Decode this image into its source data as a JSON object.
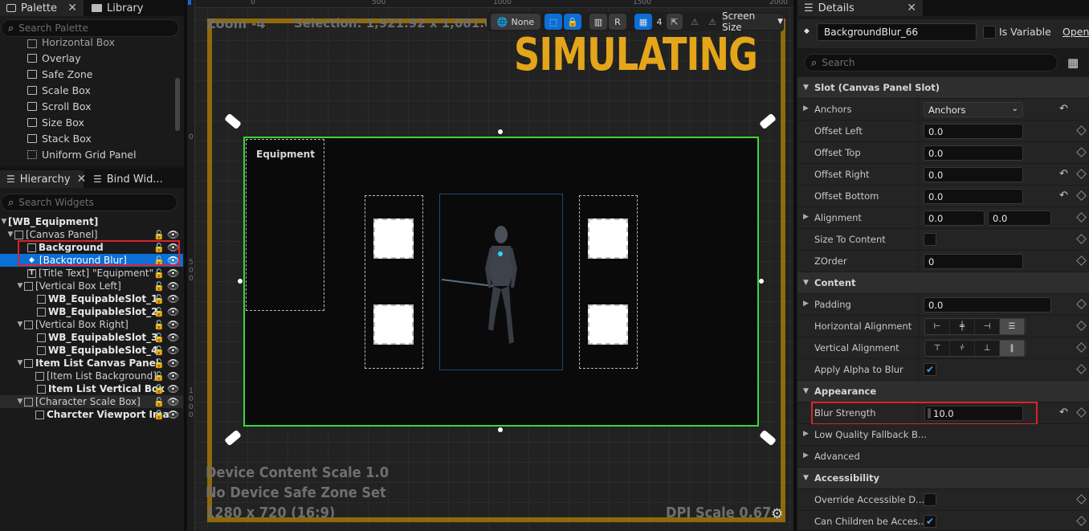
{
  "palette": {
    "tab_label": "Palette",
    "library_tab_label": "Library",
    "search_placeholder": "Search Palette",
    "items": [
      "Horizontal Box",
      "Overlay",
      "Safe Zone",
      "Scale Box",
      "Scroll Box",
      "Size Box",
      "Stack Box",
      "Uniform Grid Panel"
    ]
  },
  "hierarchy": {
    "tab_label": "Hierarchy",
    "bind_tab_label": "Bind Wid...",
    "search_placeholder": "Search Widgets",
    "items": [
      {
        "label": "[WB_Equipment]"
      },
      {
        "label": "[Canvas Panel]"
      },
      {
        "label": "Background"
      },
      {
        "label": "[Background Blur]"
      },
      {
        "label": "[Title Text] \"Equipment\""
      },
      {
        "label": "[Vertical Box Left]"
      },
      {
        "label": "WB_EquipableSlot_1"
      },
      {
        "label": "WB_EquipableSlot_2"
      },
      {
        "label": "[Vertical Box Right]"
      },
      {
        "label": "WB_EquipableSlot_3"
      },
      {
        "label": "WB_EquipableSlot_4"
      },
      {
        "label": "Item List Canvas Panel"
      },
      {
        "label": "[Item List Background]"
      },
      {
        "label": "Item List Vertical Box"
      },
      {
        "label": "[Character Scale Box]"
      },
      {
        "label": "Charcter Viewport Ima"
      }
    ]
  },
  "viewport": {
    "zoom": "Zoom -4",
    "selection": "Selection: 1,921.92 x 1,081.08",
    "simulating": "SIMULATING",
    "toolbar_none": "None",
    "toolbar_r": "R",
    "toolbar_grid": "4",
    "toolbar_screen_size": "Screen Size",
    "ruler_top": [
      "0",
      "500",
      "1000",
      "1500",
      "2000"
    ],
    "ruler_left": [
      "0",
      "5\n0\n0",
      "1\n0\n0\n0"
    ],
    "equipment_title": "Equipment",
    "device_scale": "Device Content Scale 1.0",
    "safe_zone": "No Device Safe Zone Set",
    "resolution": "1280 x 720 (16:9)",
    "dpi": "DPI Scale 0.67"
  },
  "details": {
    "tab_label": "Details",
    "widget_name": "BackgroundBlur_66",
    "is_variable_label": "Is Variable",
    "open_label": "Open",
    "search_placeholder": "Search",
    "slot_category": "Slot (Canvas Panel Slot)",
    "anchors_label": "Anchors",
    "anchors_value": "Anchors",
    "offset_left_label": "Offset Left",
    "offset_left": "0.0",
    "offset_top_label": "Offset Top",
    "offset_top": "0.0",
    "offset_right_label": "Offset Right",
    "offset_right": "0.0",
    "offset_bottom_label": "Offset Bottom",
    "offset_bottom": "0.0",
    "alignment_label": "Alignment",
    "alignment_x": "0.0",
    "alignment_y": "0.0",
    "size_to_content_label": "Size To Content",
    "zorder_label": "ZOrder",
    "zorder": "0",
    "content_category": "Content",
    "padding_label": "Padding",
    "padding": "0.0",
    "h_align_label": "Horizontal Alignment",
    "v_align_label": "Vertical Alignment",
    "apply_alpha_label": "Apply Alpha to Blur",
    "appearance_category": "Appearance",
    "blur_strength_label": "Blur Strength",
    "blur_strength": "10.0",
    "low_quality_label": "Low Quality Fallback B...",
    "advanced_label": "Advanced",
    "accessibility_category": "Accessibility",
    "override_accessible_label": "Override Accessible D...",
    "can_children_label": "Can Children be Acces..."
  },
  "colors": {
    "selection_green": "#37d837",
    "highlight_red": "#d9242e",
    "simulating_orange": "#e3a51a",
    "frame_orange": "#8f6a0c",
    "selected_row_blue": "#0c6fd6"
  }
}
